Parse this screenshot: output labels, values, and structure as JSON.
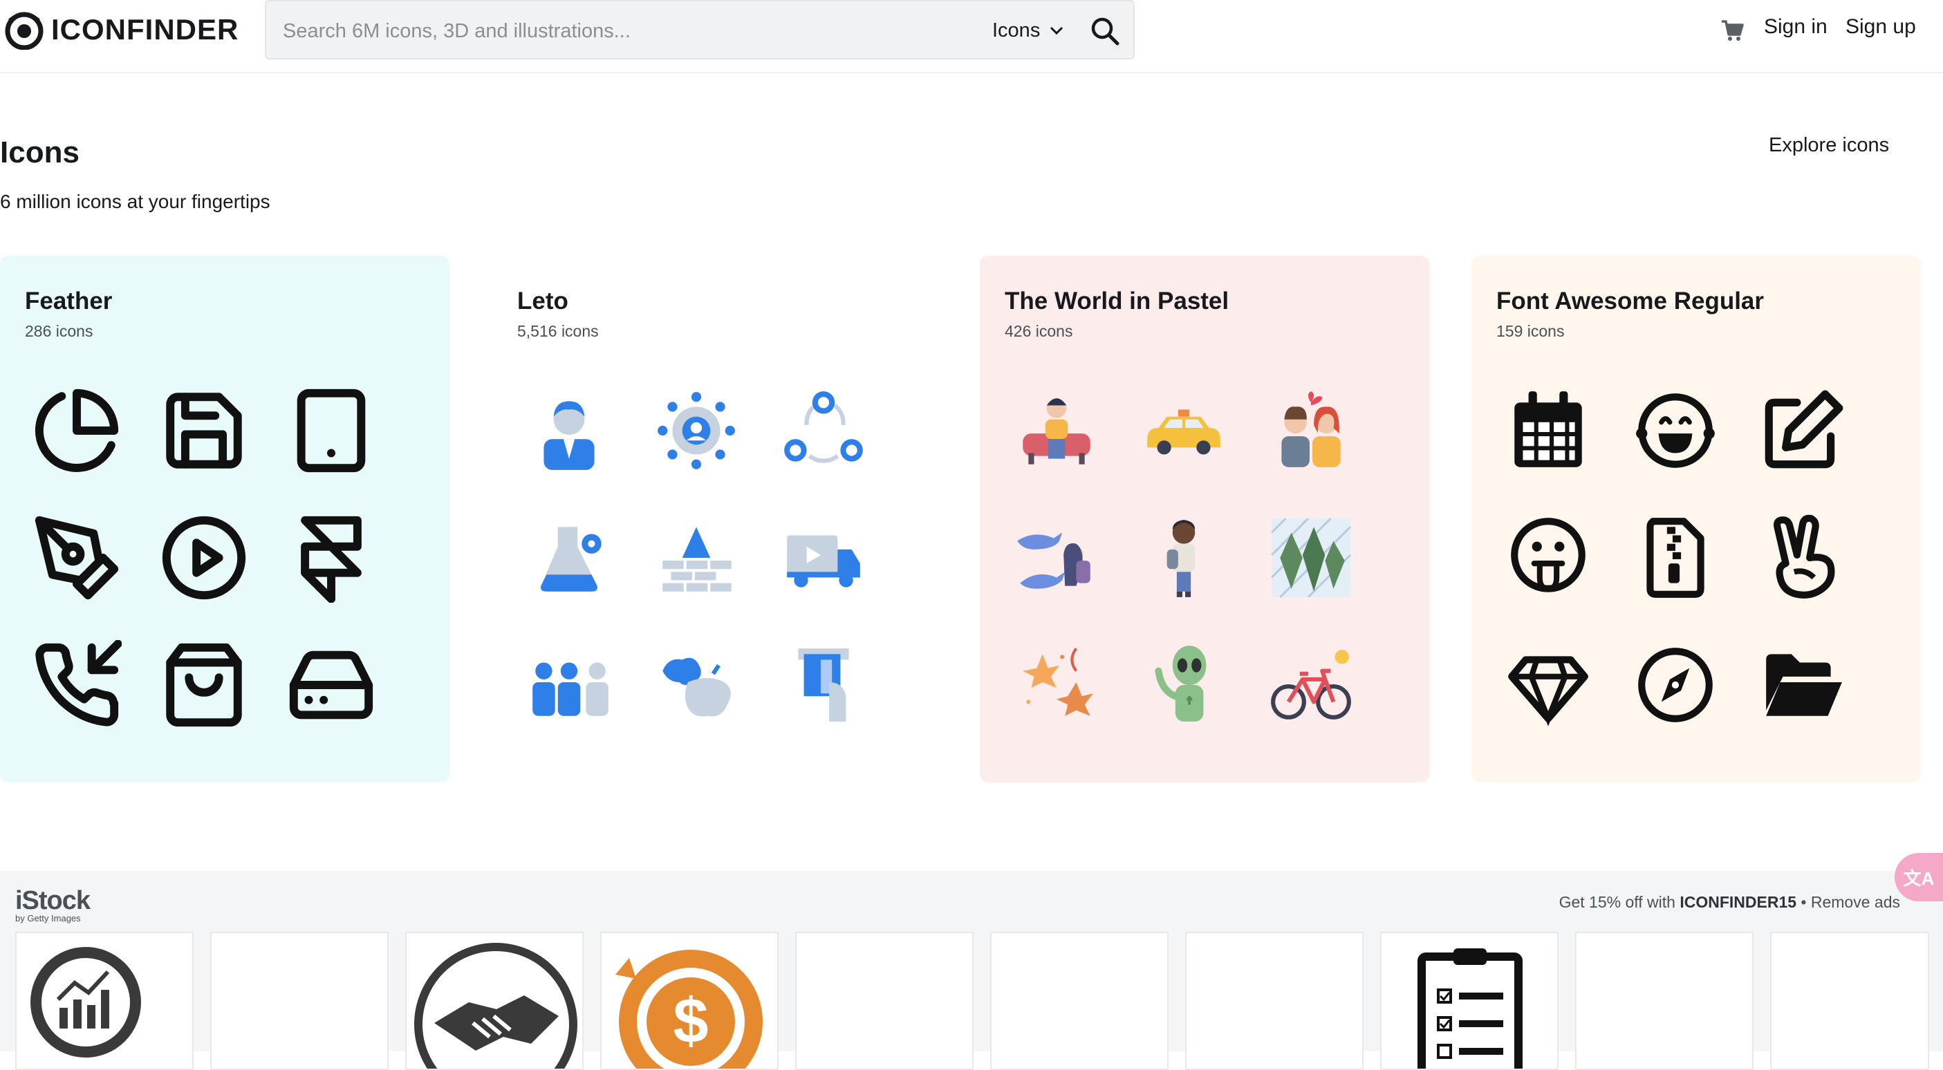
{
  "header": {
    "logo_text": "ICONFINDER",
    "search_placeholder": "Search 6M icons, 3D and illustrations...",
    "type_label": "Icons",
    "sign_in": "Sign in",
    "sign_up": "Sign up"
  },
  "page": {
    "title": "Icons",
    "subtitle": "6 million icons at your fingertips",
    "explore_label": "Explore icons"
  },
  "sets": [
    {
      "title": "Feather",
      "count": "286 icons",
      "bg": "#e8fbfa",
      "icons": [
        "pie-chart-icon",
        "save-icon",
        "tablet-icon",
        "pen-tool-icon",
        "play-circle-icon",
        "framer-icon",
        "phone-incoming-icon",
        "shopping-bag-icon",
        "hard-drive-icon"
      ]
    },
    {
      "title": "Leto",
      "count": "5,516 icons",
      "bg": "#ffffff",
      "icons": [
        "businessman-icon",
        "network-icon",
        "teamwork-cycle-icon",
        "lab-flask-icon",
        "brick-wall-mountain-icon",
        "delivery-truck-icon",
        "team-group-icon",
        "world-map-icon",
        "atm-card-icon"
      ]
    },
    {
      "title": "The World in Pastel",
      "count": "426 icons",
      "bg": "#fdecec",
      "icons": [
        "person-sofa-icon",
        "taxi-icon",
        "couple-icon",
        "sharks-diver-icon",
        "traveler-icon",
        "snowy-trees-icon",
        "autumn-leaves-icon",
        "alien-icon",
        "bicycle-icon"
      ]
    },
    {
      "title": "Font Awesome Regular",
      "count": "159 icons",
      "bg": "#fff7ed",
      "icons": [
        "calendar-icon",
        "laugh-face-icon",
        "edit-icon",
        "tongue-face-icon",
        "zip-file-icon",
        "peace-hand-icon",
        "gem-icon",
        "compass-icon",
        "folder-open-icon"
      ]
    }
  ],
  "ad": {
    "brand": "iStock",
    "brand_sub": "by Getty Images",
    "promo_prefix": "Get 15% off with",
    "promo_code": "ICONFINDER15",
    "remove_label": "Remove ads",
    "thumbs": [
      "analytics-magnifier-icon",
      "",
      "handshake-icon",
      "dollar-refresh-icon",
      "",
      "",
      "",
      "checklist-clipboard-icon",
      "",
      ""
    ]
  },
  "translate_glyph": "文A"
}
